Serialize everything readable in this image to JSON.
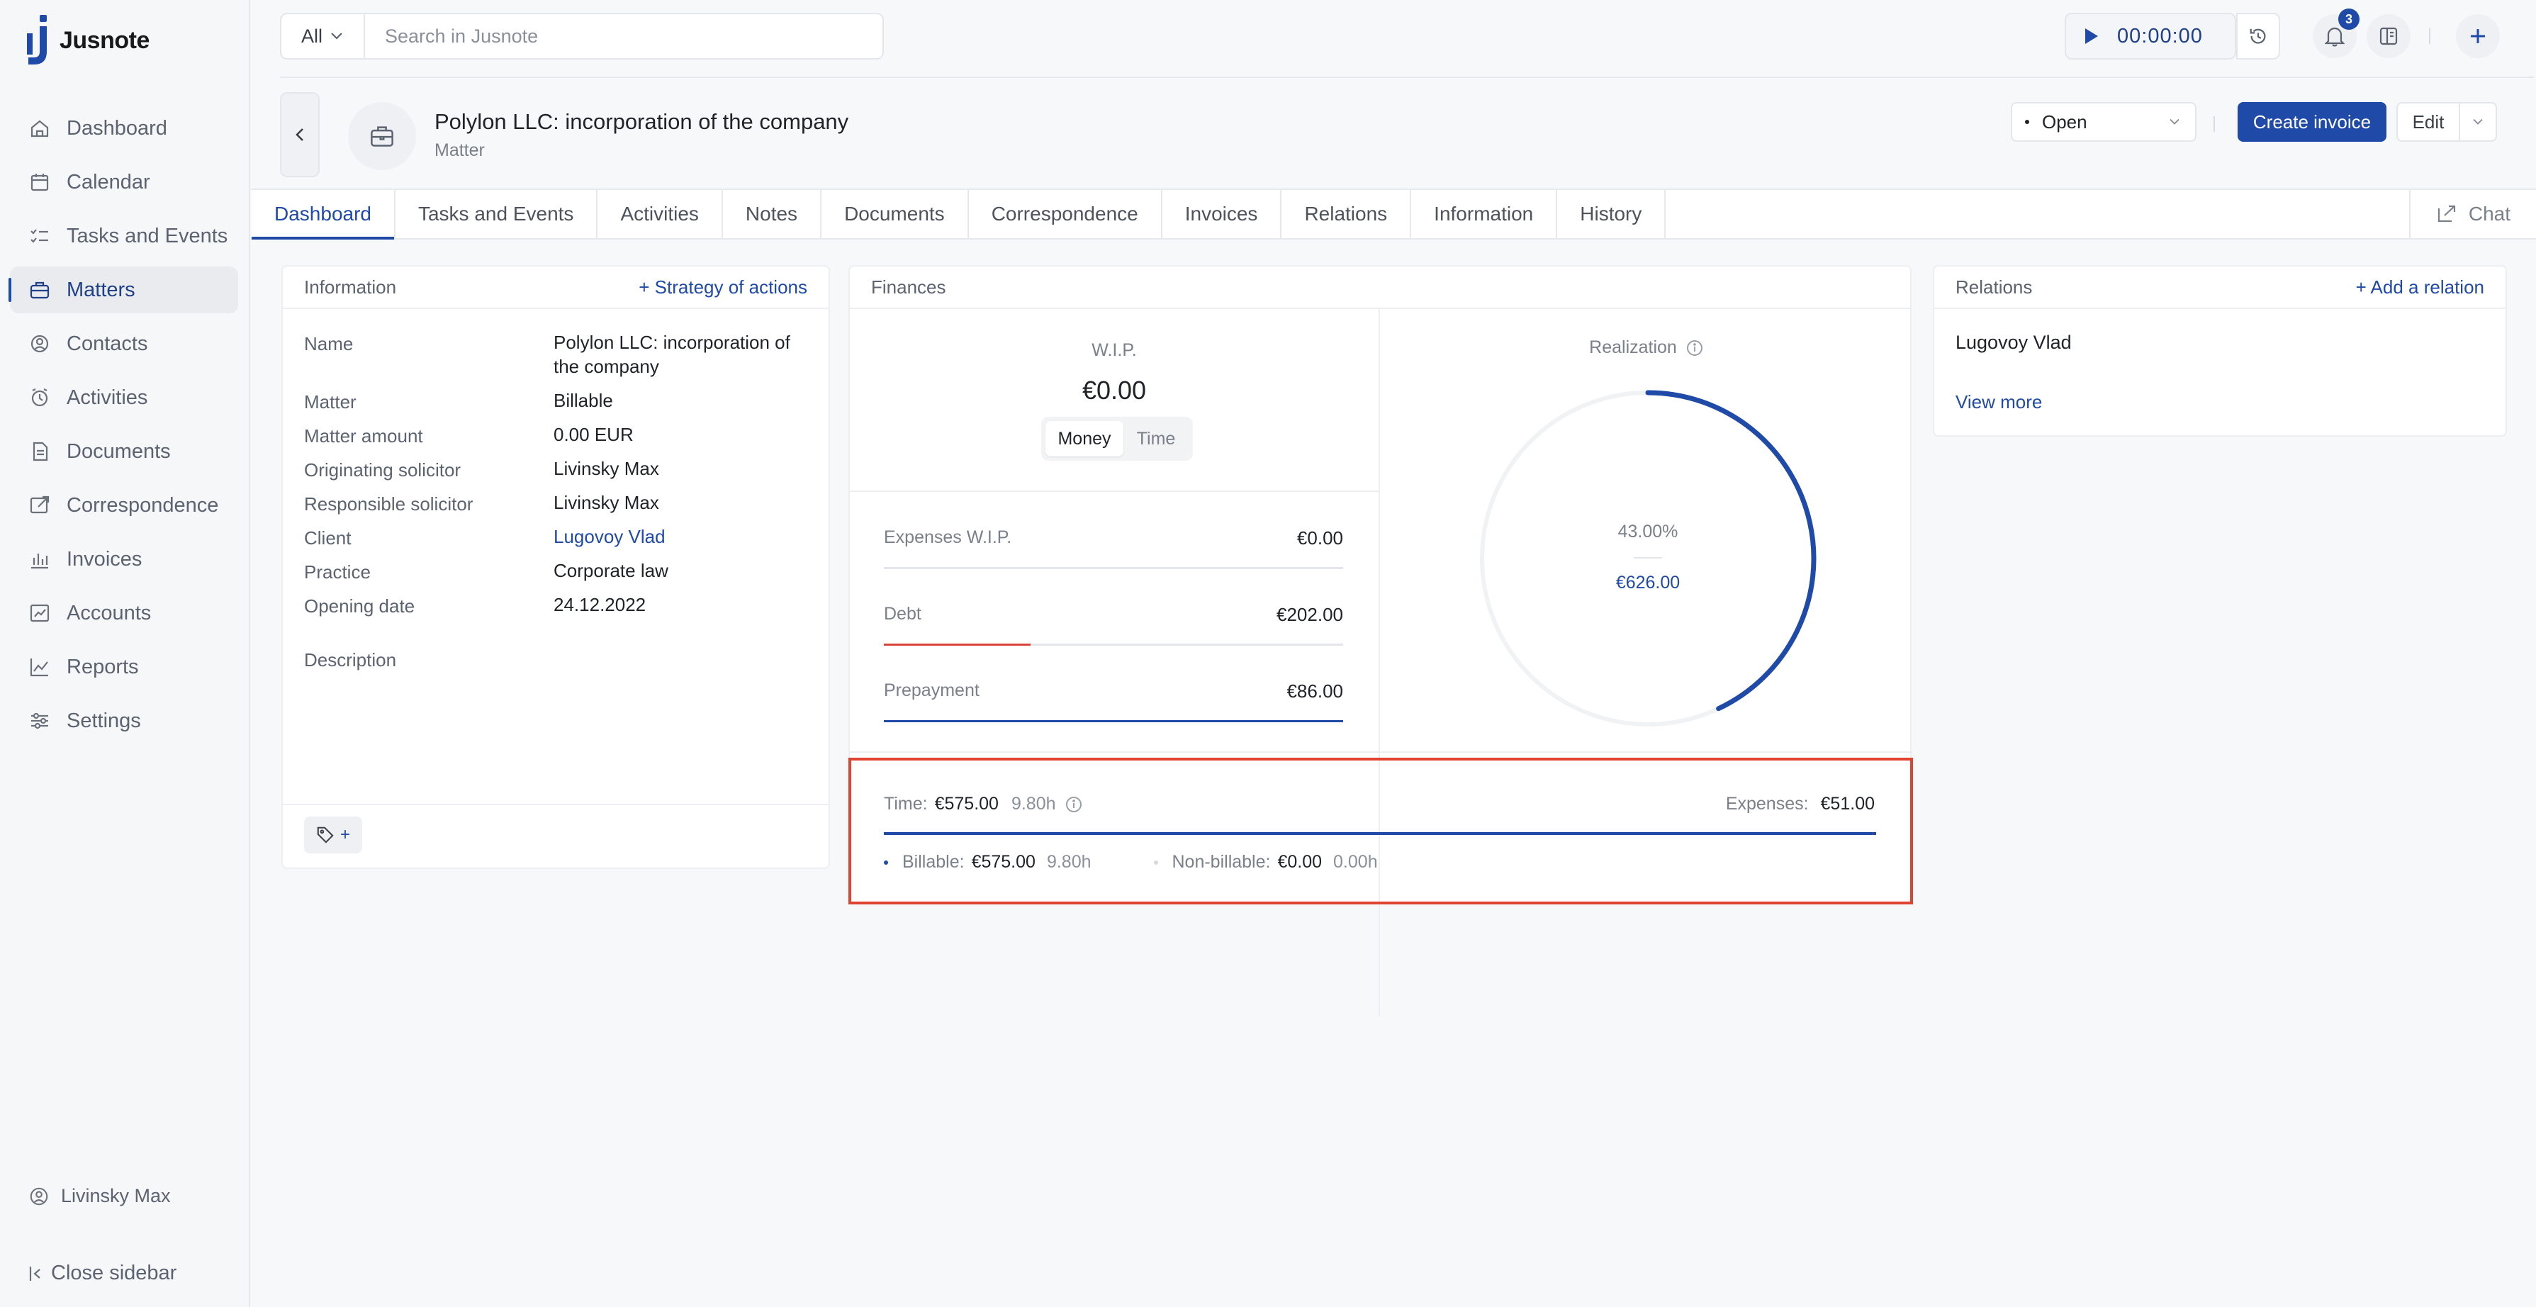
{
  "app": {
    "name": "Jusnote"
  },
  "sidebar": {
    "items": [
      {
        "label": "Dashboard",
        "icon": "home-icon"
      },
      {
        "label": "Calendar",
        "icon": "calendar-icon"
      },
      {
        "label": "Tasks and Events",
        "icon": "tasks-icon"
      },
      {
        "label": "Matters",
        "icon": "briefcase-icon",
        "active": true
      },
      {
        "label": "Contacts",
        "icon": "contacts-icon"
      },
      {
        "label": "Activities",
        "icon": "clock-icon"
      },
      {
        "label": "Documents",
        "icon": "document-icon"
      },
      {
        "label": "Correspondence",
        "icon": "correspondence-icon"
      },
      {
        "label": "Invoices",
        "icon": "invoice-icon"
      },
      {
        "label": "Accounts",
        "icon": "accounts-icon"
      },
      {
        "label": "Reports",
        "icon": "reports-icon"
      },
      {
        "label": "Settings",
        "icon": "settings-icon"
      }
    ],
    "user": "Livinsky Max",
    "close_label": "Close sidebar"
  },
  "topbar": {
    "search_scope": "All",
    "search_placeholder": "Search in Jusnote",
    "timer": "00:00:00",
    "notifications_count": "3"
  },
  "header": {
    "title": "Polylon LLC: incorporation of the company",
    "subtitle": "Matter",
    "status": "Open",
    "create_invoice": "Create invoice",
    "edit": "Edit"
  },
  "tabs": [
    {
      "label": "Dashboard",
      "active": true
    },
    {
      "label": "Tasks and Events"
    },
    {
      "label": "Activities"
    },
    {
      "label": "Notes"
    },
    {
      "label": "Documents"
    },
    {
      "label": "Correspondence"
    },
    {
      "label": "Invoices"
    },
    {
      "label": "Relations"
    },
    {
      "label": "Information"
    },
    {
      "label": "History"
    }
  ],
  "chat_label": "Chat",
  "information": {
    "title": "Information",
    "action": "+ Strategy of actions",
    "rows": [
      {
        "label": "Name",
        "value": "Polylon LLC: incorporation of the company"
      },
      {
        "label": "Matter",
        "value": "Billable"
      },
      {
        "label": "Matter amount",
        "value": "0.00 EUR"
      },
      {
        "label": "Originating solicitor",
        "value": "Livinsky Max"
      },
      {
        "label": "Responsible solicitor",
        "value": "Livinsky Max"
      },
      {
        "label": "Client",
        "value": "Lugovoy Vlad"
      },
      {
        "label": "Practice",
        "value": "Corporate law"
      },
      {
        "label": "Opening date",
        "value": "24.12.2022"
      }
    ],
    "description_label": "Description",
    "tag_add": "+"
  },
  "finances": {
    "title": "Finances",
    "wip_label": "W.I.P.",
    "wip_value": "€0.00",
    "toggle": [
      "Money",
      "Time"
    ],
    "rows": [
      {
        "label": "Expenses W.I.P.",
        "value": "€0.00",
        "fill_fraction": 0,
        "color": "#e3e6ea"
      },
      {
        "label": "Debt",
        "value": "€202.00",
        "fill_fraction": 0.32,
        "color": "#d9453a"
      },
      {
        "label": "Prepayment",
        "value": "€86.00",
        "fill_fraction": 1.0,
        "color": "#1f4aa8"
      }
    ],
    "realization_label": "Realization",
    "realization_percent": "43.00%",
    "realization_amount": "€626.00",
    "realization_fraction": 0.43,
    "time_label": "Time:",
    "time_value": "€575.00",
    "time_hours": "9.80h",
    "expenses_label": "Expenses:",
    "expenses_value": "€51.00",
    "billable_label": "Billable:",
    "billable_value": "€575.00",
    "billable_hours": "9.80h",
    "nonbillable_label": "Non-billable:",
    "nonbillable_value": "€0.00",
    "nonbillable_hours": "0.00h"
  },
  "relations": {
    "title": "Relations",
    "action": "+ Add a relation",
    "items": [
      "Lugovoy Vlad"
    ],
    "view_more": "View more"
  },
  "colors": {
    "accent": "#1f4aa8",
    "debt": "#d9453a",
    "highlight": "#e0432f"
  }
}
